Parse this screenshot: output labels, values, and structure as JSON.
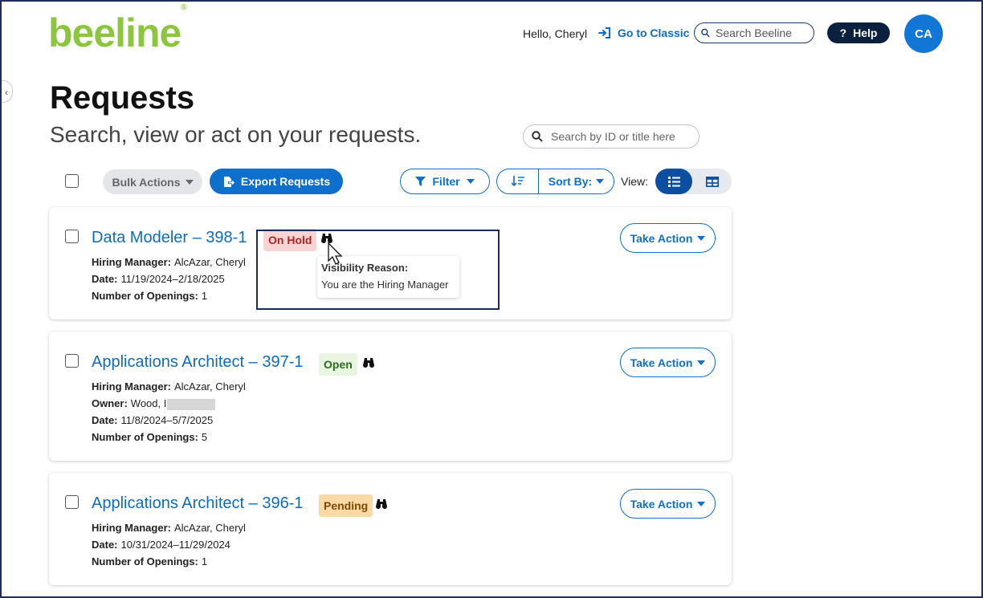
{
  "header": {
    "logo_text": "beeline",
    "logo_mark": "®",
    "greeting": "Hello, Cheryl",
    "classic_link": "Go to Classic",
    "search_placeholder": "Search Beeline",
    "help_label": "Help",
    "avatar_initials": "CA"
  },
  "page": {
    "title": "Requests",
    "subtitle": "Search, view or act on your requests.",
    "search_placeholder": "Search by ID or title here"
  },
  "toolbar": {
    "bulk_actions": "Bulk Actions",
    "export": "Export Requests",
    "filter": "Filter",
    "sort_by": "Sort By:",
    "view_label": "View:"
  },
  "requests": [
    {
      "title": "Data Modeler – 398-1",
      "status": "On Hold",
      "hiring_manager_label": "Hiring Manager:",
      "hiring_manager": "AlcAzar, Cheryl",
      "date_label": "Date:",
      "date": "11/19/2024–2/18/2025",
      "openings_label": "Number of Openings:",
      "openings": "1",
      "action": "Take Action"
    },
    {
      "title": "Applications Architect – 397-1",
      "status": "Open",
      "hiring_manager_label": "Hiring Manager:",
      "hiring_manager": "AlcAzar, Cheryl",
      "owner_label": "Owner:",
      "owner": "Wood, I",
      "date_label": "Date:",
      "date": "11/8/2024–5/7/2025",
      "openings_label": "Number of Openings:",
      "openings": "5",
      "action": "Take Action"
    },
    {
      "title": "Applications Architect – 396-1",
      "status": "Pending",
      "hiring_manager_label": "Hiring Manager:",
      "hiring_manager": "AlcAzar, Cheryl",
      "date_label": "Date:",
      "date": "10/31/2024–11/29/2024",
      "openings_label": "Number of Openings:",
      "openings": "1",
      "action": "Take Action"
    }
  ],
  "tooltip": {
    "title": "Visibility Reason:",
    "text": "You are the Hiring Manager"
  },
  "colors": {
    "brand_green": "#8cc63f",
    "primary_blue": "#0e6fcd",
    "navy": "#0b1f3f"
  }
}
